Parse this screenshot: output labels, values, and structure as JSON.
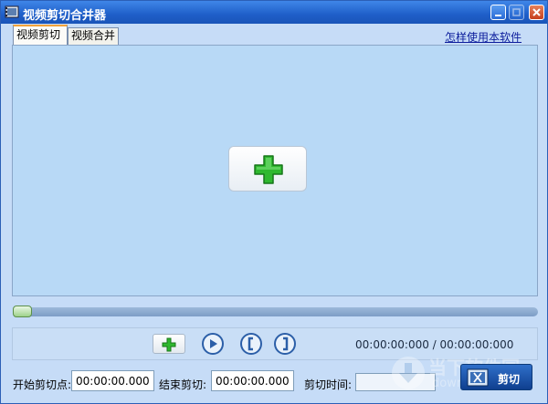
{
  "window": {
    "title": "视频剪切合并器"
  },
  "tabs": [
    {
      "label": "视频剪切",
      "active": true
    },
    {
      "label": "视频合并",
      "active": false
    }
  ],
  "help_link": "怎样使用本软件",
  "preview": {
    "add_icon": "plus-icon"
  },
  "controls": {
    "time_current": "00:00:00:000",
    "time_separator": "/",
    "time_total": "00:00:00:000",
    "icons": [
      "plus-icon",
      "play-icon",
      "mark-in-icon",
      "mark-out-icon"
    ]
  },
  "cut_settings": {
    "start_label": "开始剪切点:",
    "start_value": "00:00:00.000",
    "end_label": "结束剪切:",
    "end_value": "00:00:00.000",
    "duration_label": "剪切时间:",
    "duration_value": ""
  },
  "cut_button": {
    "label": "剪切"
  },
  "watermark": {
    "line1": "当下软件园",
    "line2": "downxia.com"
  },
  "colors": {
    "titlebar": "#1f5fc9",
    "background": "#c6dcf7",
    "preview": "#b8d9f6",
    "plus_green": "#2aa52a",
    "cut_button": "#1a4ea0"
  }
}
